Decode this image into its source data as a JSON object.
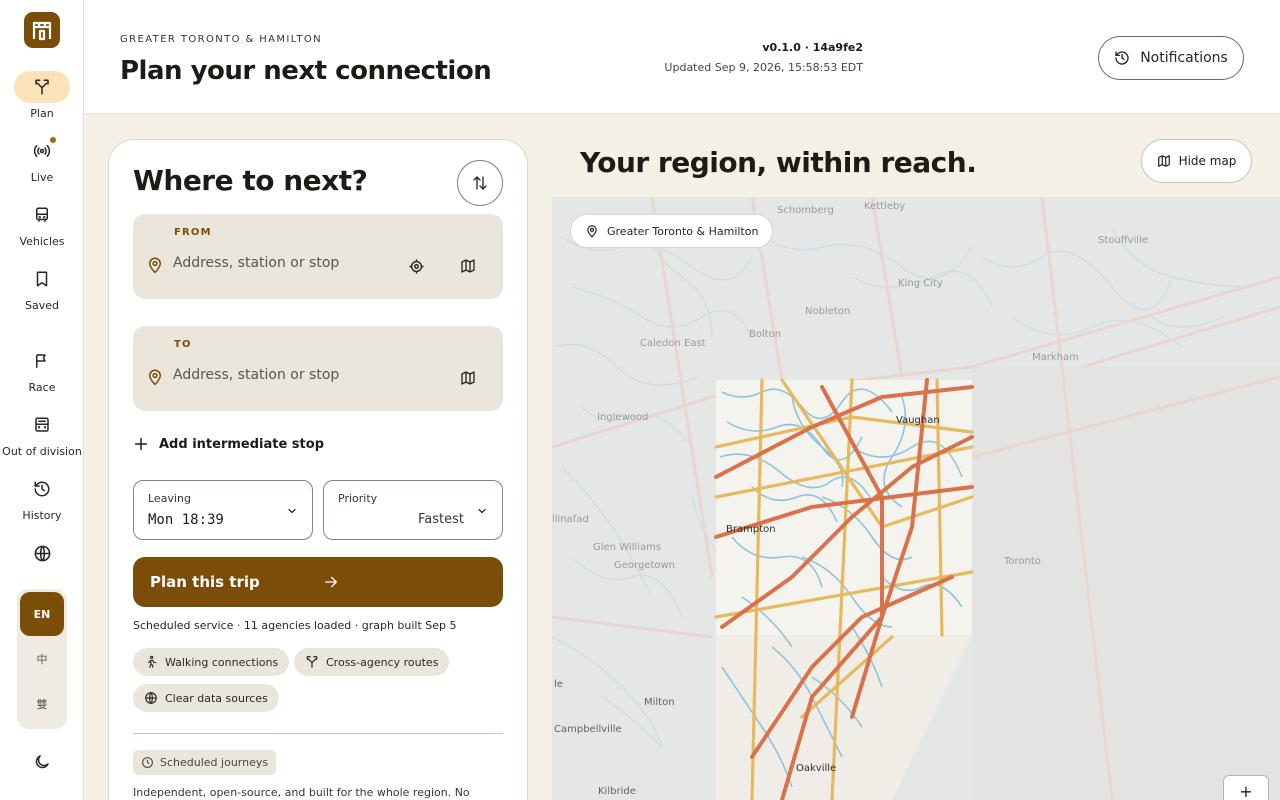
{
  "sidebar": {
    "logo_icon": "transit-shelter-icon",
    "items": [
      {
        "label": "Plan",
        "icon": "route-split-icon",
        "active": true
      },
      {
        "label": "Live",
        "icon": "broadcast-icon"
      },
      {
        "label": "Vehicles",
        "icon": "bus-icon"
      },
      {
        "label": "Saved",
        "icon": "bookmark-icon"
      },
      {
        "label": "Race",
        "icon": "flag-icon"
      },
      {
        "label": "Out of division",
        "icon": "car-icon"
      },
      {
        "label": "History",
        "icon": "history-icon"
      }
    ],
    "globe_icon": "globe-icon",
    "languages": [
      {
        "label": "EN",
        "active": true
      },
      {
        "label": "中"
      },
      {
        "label": "雙"
      }
    ],
    "theme_icon": "moon-icon"
  },
  "header": {
    "region": "GREATER TORONTO & HAMILTON",
    "title": "Plan your next connection",
    "version": "v0.1.0 · 14a9fe2",
    "updated": "Updated Sep 9, 2026, 15:58:53 EDT",
    "notifications_label": "Notifications"
  },
  "planner": {
    "title": "Where to next?",
    "from": {
      "label": "FROM",
      "placeholder": "Address, station or stop",
      "value": ""
    },
    "to": {
      "label": "TO",
      "placeholder": "Address, station or stop",
      "value": ""
    },
    "add_stop_label": "Add intermediate stop",
    "leaving": {
      "label": "Leaving",
      "value": "Mon 18:39"
    },
    "priority": {
      "label": "Priority",
      "value": "Fastest"
    },
    "plan_button": "Plan this trip",
    "status": "Scheduled service · 11 agencies loaded · graph built Sep 5",
    "chips": [
      "Walking connections",
      "Cross-agency routes",
      "Clear data sources"
    ],
    "scheduled_badge": "Scheduled journeys",
    "intro": "Independent, open-source, and built for the whole region. No"
  },
  "map": {
    "heading": "Your region, within reach.",
    "hide_map_label": "Hide map",
    "region_chip": "Greater Toronto & Hamilton",
    "zoom_in_label": "+",
    "places": [
      "Schomberg",
      "Kettleby",
      "Stouffville",
      "King City",
      "Nobleton",
      "Bolton",
      "Caledon East",
      "Markham",
      "Inglewood",
      "Vaughan",
      "Brampton",
      "Glen Williams",
      "Georgetown",
      "Toronto",
      "Milton",
      "Campbellville",
      "Oakville",
      "Kilbride",
      "llinafad",
      "le"
    ]
  },
  "colors": {
    "accent": "#7a4e08",
    "accent_soft": "#fbe2b8",
    "field_bg": "#ebe6dc",
    "page_bg": "#f4f0e6",
    "water": "#8fc3dc",
    "road_major": "#d9724a",
    "road_minor": "#e6b95e"
  }
}
